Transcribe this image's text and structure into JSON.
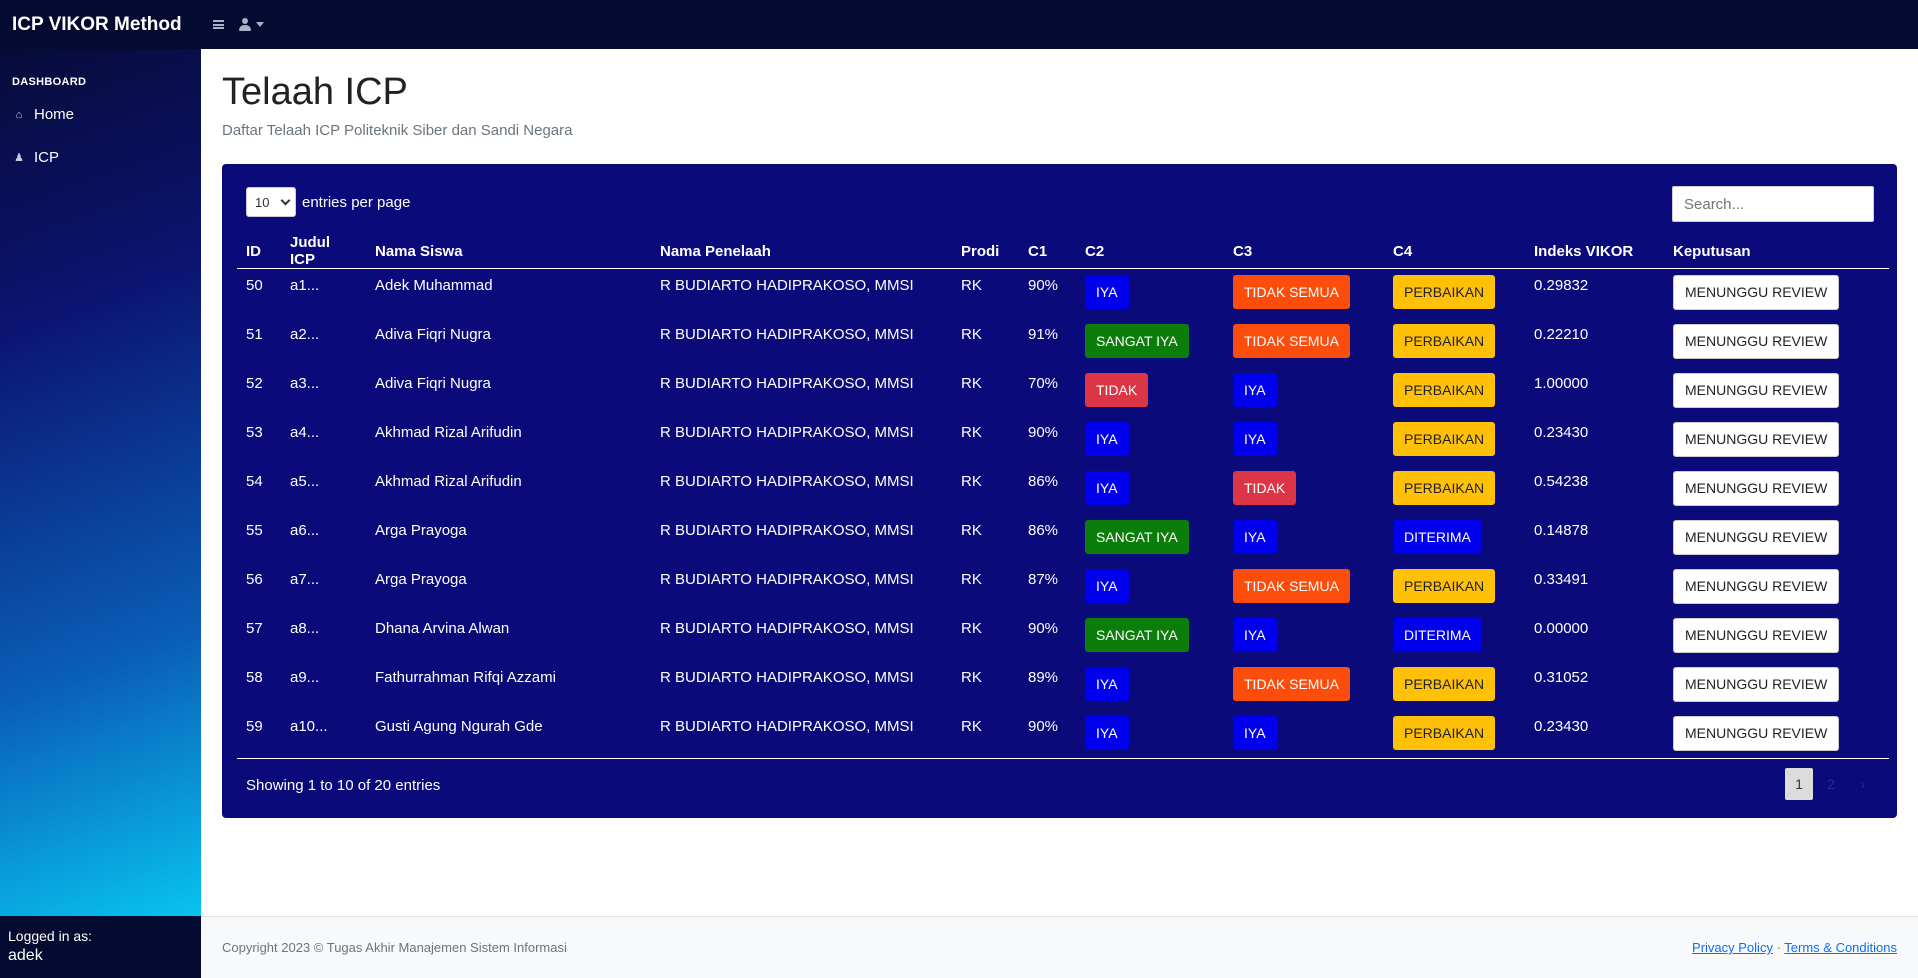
{
  "brand": "ICP VIKOR Method",
  "sidebar": {
    "heading": "DASHBOARD",
    "items": [
      {
        "label": "Home",
        "icon": "home-icon"
      },
      {
        "label": "ICP",
        "icon": "bell-icon"
      }
    ],
    "logged_in_label": "Logged in as:",
    "logged_in_user": "adek"
  },
  "page": {
    "title": "Telaah ICP",
    "subtitle": "Daftar Telaah ICP Politeknik Siber dan Sandi Negara"
  },
  "table_controls": {
    "entries_value": "10",
    "entries_label": "entries per page",
    "search_placeholder": "Search..."
  },
  "colors": {
    "IYA": "#0000ee",
    "SANGAT IYA": "#0a7d0a",
    "TIDAK": "#dc3545",
    "TIDAK SEMUA": "#fd4d0d",
    "PERBAIKAN": "#ffc107",
    "DITERIMA": "#0000ee"
  },
  "table": {
    "headers": [
      "ID",
      "Judul ICP",
      "Nama Siswa",
      "Nama Penelaah",
      "Prodi",
      "C1",
      "C2",
      "C3",
      "C4",
      "Indeks VIKOR",
      "Keputusan"
    ],
    "rows": [
      {
        "id": "50",
        "judul": "a1...",
        "siswa": "Adek Muhammad",
        "penelaah": "R BUDIARTO HADIPRAKOSO, MMSI",
        "prodi": "RK",
        "c1": "90%",
        "c2": "IYA",
        "c3": "TIDAK SEMUA",
        "c4": "PERBAIKAN",
        "vikor": "0.29832",
        "keputusan": "MENUNGGU REVIEW"
      },
      {
        "id": "51",
        "judul": "a2...",
        "siswa": "Adiva Fiqri Nugra",
        "penelaah": "R BUDIARTO HADIPRAKOSO, MMSI",
        "prodi": "RK",
        "c1": "91%",
        "c2": "SANGAT IYA",
        "c3": "TIDAK SEMUA",
        "c4": "PERBAIKAN",
        "vikor": "0.22210",
        "keputusan": "MENUNGGU REVIEW"
      },
      {
        "id": "52",
        "judul": "a3...",
        "siswa": "Adiva Fiqri Nugra",
        "penelaah": "R BUDIARTO HADIPRAKOSO, MMSI",
        "prodi": "RK",
        "c1": "70%",
        "c2": "TIDAK",
        "c3": "IYA",
        "c4": "PERBAIKAN",
        "vikor": "1.00000",
        "keputusan": "MENUNGGU REVIEW"
      },
      {
        "id": "53",
        "judul": "a4...",
        "siswa": "Akhmad Rizal Arifudin",
        "penelaah": "R BUDIARTO HADIPRAKOSO, MMSI",
        "prodi": "RK",
        "c1": "90%",
        "c2": "IYA",
        "c3": "IYA",
        "c4": "PERBAIKAN",
        "vikor": "0.23430",
        "keputusan": "MENUNGGU REVIEW"
      },
      {
        "id": "54",
        "judul": "a5...",
        "siswa": "Akhmad Rizal Arifudin",
        "penelaah": "R BUDIARTO HADIPRAKOSO, MMSI",
        "prodi": "RK",
        "c1": "86%",
        "c2": "IYA",
        "c3": "TIDAK",
        "c4": "PERBAIKAN",
        "vikor": "0.54238",
        "keputusan": "MENUNGGU REVIEW"
      },
      {
        "id": "55",
        "judul": "a6...",
        "siswa": "Arga Prayoga",
        "penelaah": "R BUDIARTO HADIPRAKOSO, MMSI",
        "prodi": "RK",
        "c1": "86%",
        "c2": "SANGAT IYA",
        "c3": "IYA",
        "c4": "DITERIMA",
        "vikor": "0.14878",
        "keputusan": "MENUNGGU REVIEW"
      },
      {
        "id": "56",
        "judul": "a7...",
        "siswa": "Arga Prayoga",
        "penelaah": "R BUDIARTO HADIPRAKOSO, MMSI",
        "prodi": "RK",
        "c1": "87%",
        "c2": "IYA",
        "c3": "TIDAK SEMUA",
        "c4": "PERBAIKAN",
        "vikor": "0.33491",
        "keputusan": "MENUNGGU REVIEW"
      },
      {
        "id": "57",
        "judul": "a8...",
        "siswa": "Dhana Arvina Alwan",
        "penelaah": "R BUDIARTO HADIPRAKOSO, MMSI",
        "prodi": "RK",
        "c1": "90%",
        "c2": "SANGAT IYA",
        "c3": "IYA",
        "c4": "DITERIMA",
        "vikor": "0.00000",
        "keputusan": "MENUNGGU REVIEW"
      },
      {
        "id": "58",
        "judul": "a9...",
        "siswa": "Fathurrahman Rifqi Azzami",
        "penelaah": "R BUDIARTO HADIPRAKOSO, MMSI",
        "prodi": "RK",
        "c1": "89%",
        "c2": "IYA",
        "c3": "TIDAK SEMUA",
        "c4": "PERBAIKAN",
        "vikor": "0.31052",
        "keputusan": "MENUNGGU REVIEW"
      },
      {
        "id": "59",
        "judul": "a10...",
        "siswa": "Gusti Agung Ngurah Gde",
        "penelaah": "R BUDIARTO HADIPRAKOSO, MMSI",
        "prodi": "RK",
        "c1": "90%",
        "c2": "IYA",
        "c3": "IYA",
        "c4": "PERBAIKAN",
        "vikor": "0.23430",
        "keputusan": "MENUNGGU REVIEW"
      }
    ],
    "info": "Showing 1 to 10 of 20 entries",
    "pagination": [
      "1",
      "2",
      "›"
    ]
  },
  "footer": {
    "copyright": "Copyright 2023 © Tugas Akhir Manajemen Sistem Informasi",
    "privacy": "Privacy Policy",
    "separator": " · ",
    "terms": "Terms & Conditions"
  }
}
